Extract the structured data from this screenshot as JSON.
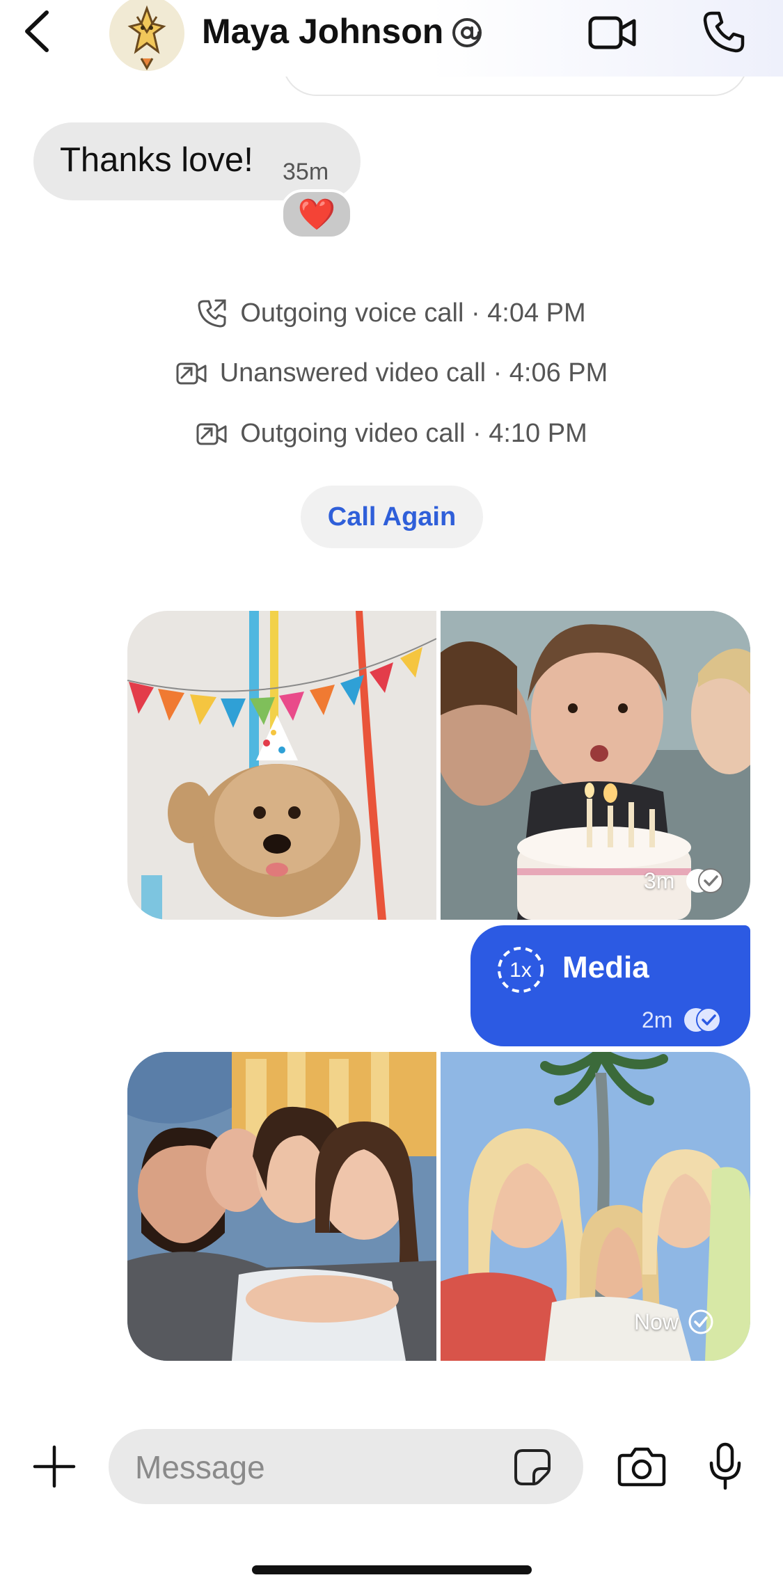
{
  "header": {
    "contact_name": "Maya Johnson",
    "back_icon": "chevron-left-icon",
    "verified_icon": "at-sign-icon",
    "video_call_icon": "video-camera-icon",
    "voice_call_icon": "phone-icon"
  },
  "incoming_message": {
    "text": "Thanks love!",
    "time": "35m",
    "reaction": "❤️"
  },
  "call_log": [
    {
      "icon": "outgoing-call-icon",
      "text": "Outgoing voice call · 4:04 PM"
    },
    {
      "icon": "missed-video-call-icon",
      "text": "Unanswered video call · 4:06 PM"
    },
    {
      "icon": "outgoing-video-call-icon",
      "text": "Outgoing video call · 4:10 PM"
    }
  ],
  "call_again_label": "Call Again",
  "media_group_1": {
    "images": [
      "party-dog-photo",
      "birthday-cake-photo"
    ],
    "time": "3m",
    "status_icon": "read-double-check-icon"
  },
  "media_message": {
    "view_once_label": "1x",
    "label": "Media",
    "time": "2m",
    "status_icon": "read-double-check-icon"
  },
  "media_group_2": {
    "images": [
      "friends-hug-photo",
      "friends-palm-tree-photo"
    ],
    "time": "Now",
    "status_icon": "sent-check-icon"
  },
  "composer": {
    "placeholder": "Message",
    "value": ""
  },
  "colors": {
    "accent": "#2c5ae3",
    "link": "#2f5fd9",
    "incoming_bubble": "#e9e9e9"
  }
}
